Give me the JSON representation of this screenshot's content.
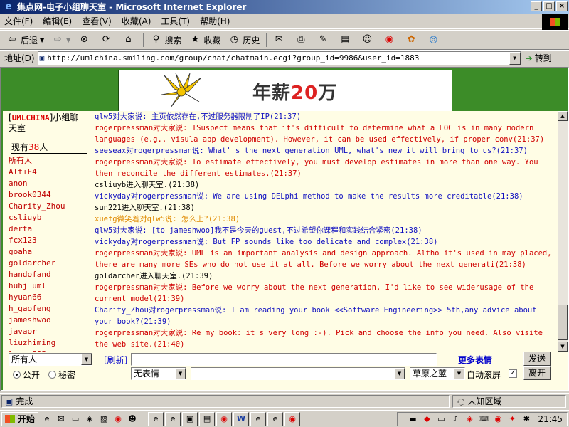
{
  "window": {
    "title": "集点网-电子小组聊天室 - Microsoft Internet Explorer",
    "controls": [
      "_",
      "□",
      "×"
    ]
  },
  "menu": [
    "文件(F)",
    "编辑(E)",
    "查看(V)",
    "收藏(A)",
    "工具(T)",
    "帮助(H)"
  ],
  "toolbar": {
    "back": "后退",
    "search": "搜索",
    "favorites": "收藏",
    "history": "历史"
  },
  "address": {
    "label": "地址(D)",
    "url": "http://umlchina.smiling.com/group/chat/chatmain.ecgi?group_id=9986&user_id=1883",
    "go": "转到"
  },
  "banner": {
    "text_prefix": "年薪",
    "text_num": "20",
    "text_suffix": "万"
  },
  "sidebar": {
    "group_prefix": "[",
    "group_name": "UMLCHINA",
    "group_suffix": "]小组聊天室",
    "online_prefix": "现有",
    "online_count": "38",
    "online_suffix": "人",
    "users": [
      "所有人",
      "Alt+F4",
      "anon",
      "brook0344",
      "Charity_Zhou",
      "csliuyb",
      "derta",
      "fcx123",
      "goaha",
      "goldarcher",
      "handofand",
      "huhj_uml",
      "hyuan66",
      "h_gaofeng",
      "jameshwoo",
      "javaor",
      "liuzhiming",
      "lyang585"
    ]
  },
  "chat": [
    {
      "color": "blue",
      "text": "qlw5对大家说: 主页依然存在,不过服务器限制了IP(21:37)"
    },
    {
      "color": "red",
      "text": "rogerpressman对大家说: ISuspect means that it's difficult to determine what a LOC is in many modern languages (e.g., visula app development). However, it can be used effectively, if proper conv(21:37)"
    },
    {
      "color": "blue",
      "text": "seeseax对rogerpressman说: What' s the next generation UML, what's new it will bring to us?(21:37)"
    },
    {
      "color": "red",
      "text": "rogerpressman对大家说: To estimate effectively, you must develop estimates in more than one way. You then reconcile the different estimates.(21:37)"
    },
    {
      "color": "black",
      "text": "csliuyb进入聊天室.(21:38)"
    },
    {
      "color": "blue",
      "text": "vickyday对rogerpressman说: We are using DELphi method to make the results more creditable(21:38)"
    },
    {
      "color": "black",
      "text": "sun221进入聊天室.(21:38)"
    },
    {
      "color": "orange",
      "text": "xuefg微笑着对qlw5说: 怎么上?(21:38)"
    },
    {
      "color": "blue",
      "text": "qlw5对大家说: [to jameshwoo]我不是今天的guest,不过希望你课程和实践结合紧密(21:38)"
    },
    {
      "color": "blue",
      "text": "vickyday对rogerpressman说: But FP sounds like too delicate and complex(21:38)"
    },
    {
      "color": "red",
      "text": "rogerpressman对大家说: UML is an important analysis and design approach. Altho it's used in may placed, there are many more SEs who do not use it at all. Before we worry about the next generati(21:38)"
    },
    {
      "color": "black",
      "text": "goldarcher进入聊天室.(21:39)"
    },
    {
      "color": "red",
      "text": "rogerpressman对大家说: Before we worry about the next generation, I'd like to see widerusage of the current model(21:39)"
    },
    {
      "color": "blue",
      "text": "Charity_Zhou对rogerpressman说: I am reading your book <<Software Engineering>> 5th,any advice about your book?(21:39)"
    },
    {
      "color": "red",
      "text": "rogerpressman对大家说: Re my book: it's very long :-). Pick and choose the info you need. Also visite the web site.(21:40)"
    }
  ],
  "controls": {
    "target": "所有人",
    "refresh": "[刷新]",
    "more_emotes": "更多表情",
    "send": "发送",
    "leave": "离开",
    "public": "公开",
    "private": "秘密",
    "emotion": "无表情",
    "theme": "草原之蓝",
    "autoscroll": "自动滚屏"
  },
  "status": {
    "left": "完成",
    "zone": "未知区域"
  },
  "taskbar": {
    "start": "开始",
    "clock": "21:45"
  }
}
